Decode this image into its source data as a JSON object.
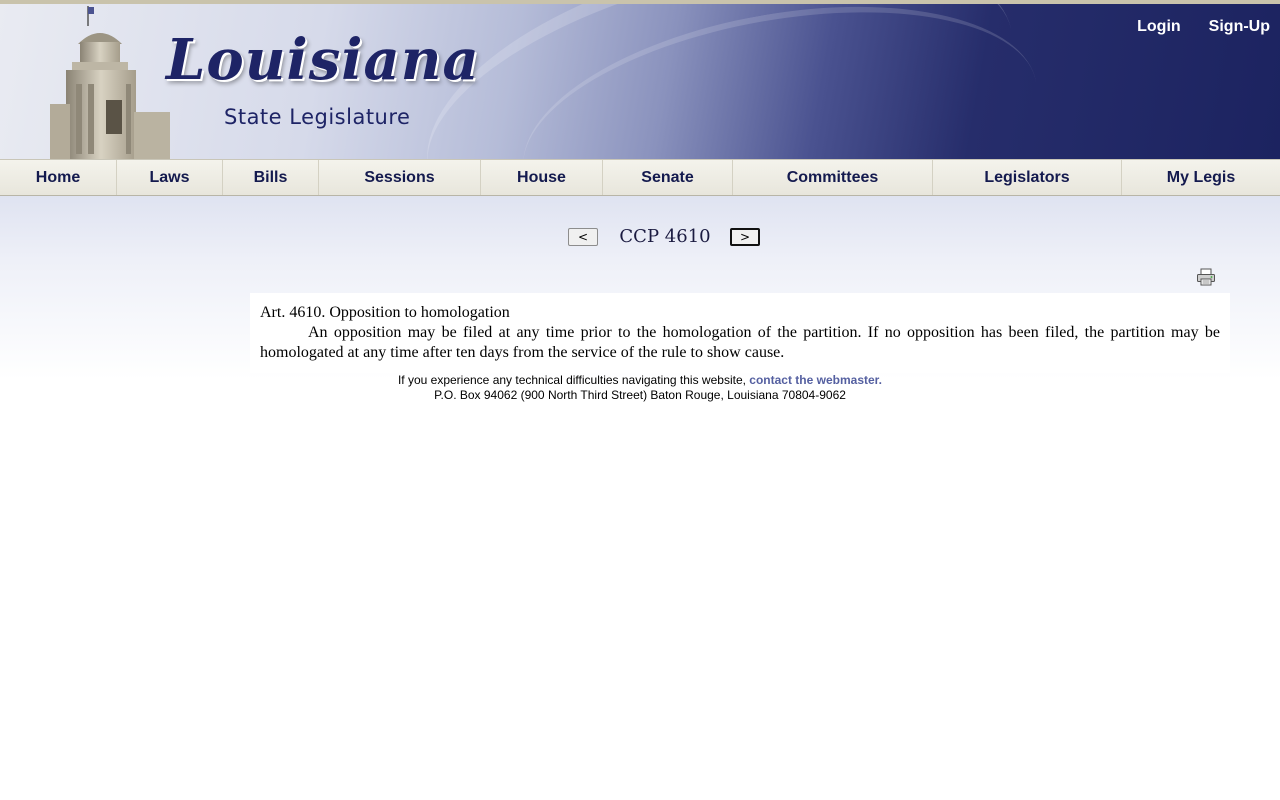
{
  "header": {
    "logo_main": "Louisiana",
    "logo_sub": "State Legislature",
    "login_label": "Login",
    "signup_label": "Sign-Up"
  },
  "nav": {
    "items": [
      {
        "label": "Home"
      },
      {
        "label": "Laws"
      },
      {
        "label": "Bills"
      },
      {
        "label": "Sessions"
      },
      {
        "label": "House"
      },
      {
        "label": "Senate"
      },
      {
        "label": "Committees"
      },
      {
        "label": "Legislators"
      },
      {
        "label": "My Legis"
      }
    ]
  },
  "pager": {
    "prev_label": "<",
    "next_label": ">",
    "title": "CCP 4610"
  },
  "icons": {
    "print": "print-icon"
  },
  "article": {
    "heading": "Art. 4610.  Opposition to homologation",
    "body": "An opposition may be filed at any time prior to the homologation of the partition.  If no opposition has been filed, the partition may be homologated at any time after ten days from the service of the rule to show cause."
  },
  "footer": {
    "notice_text": "If you experience any technical difficulties navigating this website,",
    "webmaster_link": "contact the webmaster.",
    "address": "P.O. Box 94062 (900 North Third Street) Baton Rouge, Louisiana 70804-9062"
  },
  "colors": {
    "brand_navy": "#1e2466",
    "nav_text": "#141a4e",
    "link": "#545fa0"
  }
}
